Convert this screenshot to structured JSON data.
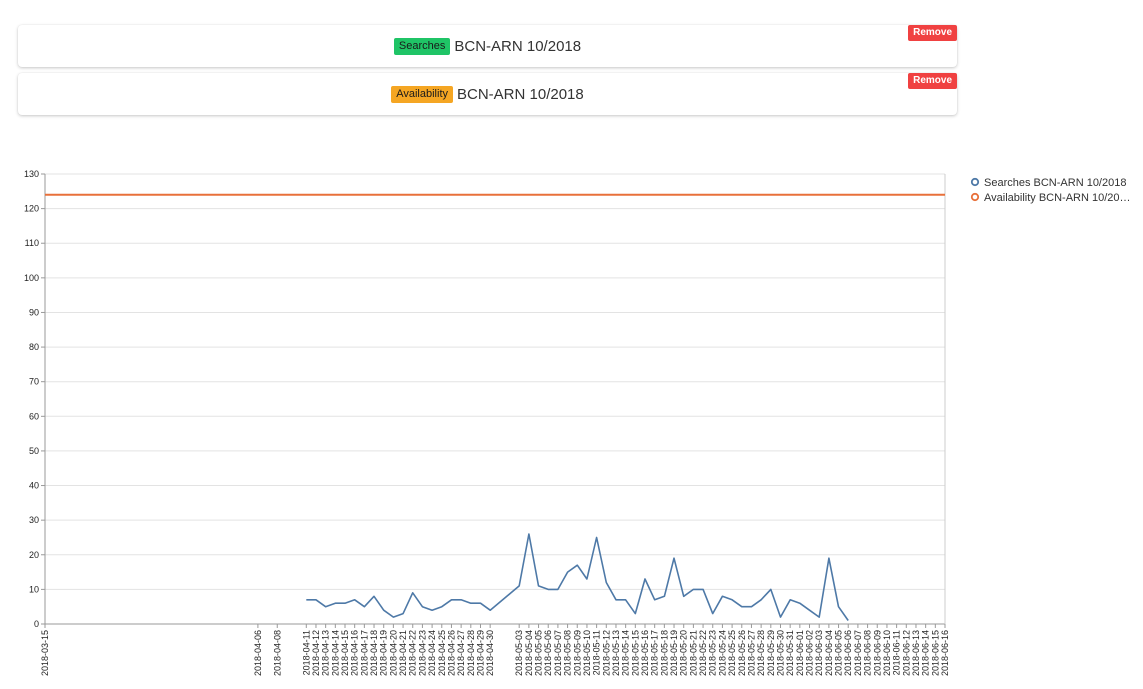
{
  "cards": [
    {
      "tag": "Searches",
      "tag_color": "#1fc466",
      "tag_text_color": "#1a1a1a",
      "route": "BCN-ARN 10/2018",
      "remove_label": "Remove"
    },
    {
      "tag": "Availability",
      "tag_color": "#f5a623",
      "tag_text_color": "#1a1a1a",
      "route": "BCN-ARN 10/2018",
      "remove_label": "Remove"
    }
  ],
  "remove_color": "#f04141",
  "chart_data": {
    "type": "line",
    "ylim": [
      0,
      130
    ],
    "yticks": [
      0,
      10,
      20,
      30,
      40,
      50,
      60,
      70,
      80,
      90,
      100,
      110,
      120,
      130
    ],
    "grid": true,
    "legend_position": "right",
    "series": [
      {
        "name": "Searches BCN-ARN 10/2018",
        "color": "#4e79a7",
        "points": [
          [
            "2018-04-11",
            7
          ],
          [
            "2018-04-12",
            7
          ],
          [
            "2018-04-13",
            5
          ],
          [
            "2018-04-14",
            6
          ],
          [
            "2018-04-15",
            6
          ],
          [
            "2018-04-16",
            7
          ],
          [
            "2018-04-17",
            5
          ],
          [
            "2018-04-18",
            8
          ],
          [
            "2018-04-19",
            4
          ],
          [
            "2018-04-20",
            2
          ],
          [
            "2018-04-21",
            3
          ],
          [
            "2018-04-22",
            9
          ],
          [
            "2018-04-23",
            5
          ],
          [
            "2018-04-24",
            4
          ],
          [
            "2018-04-25",
            5
          ],
          [
            "2018-04-26",
            7
          ],
          [
            "2018-04-27",
            7
          ],
          [
            "2018-04-28",
            6
          ],
          [
            "2018-04-29",
            6
          ],
          [
            "2018-04-30",
            4
          ],
          [
            "2018-05-03",
            11
          ],
          [
            "2018-05-04",
            26
          ],
          [
            "2018-05-05",
            11
          ],
          [
            "2018-05-06",
            10
          ],
          [
            "2018-05-07",
            10
          ],
          [
            "2018-05-08",
            15
          ],
          [
            "2018-05-09",
            17
          ],
          [
            "2018-05-10",
            13
          ],
          [
            "2018-05-11",
            25
          ],
          [
            "2018-05-12",
            12
          ],
          [
            "2018-05-13",
            7
          ],
          [
            "2018-05-14",
            7
          ],
          [
            "2018-05-15",
            3
          ],
          [
            "2018-05-16",
            13
          ],
          [
            "2018-05-17",
            7
          ],
          [
            "2018-05-18",
            8
          ],
          [
            "2018-05-19",
            19
          ],
          [
            "2018-05-20",
            8
          ],
          [
            "2018-05-21",
            10
          ],
          [
            "2018-05-22",
            10
          ],
          [
            "2018-05-23",
            3
          ],
          [
            "2018-05-24",
            8
          ],
          [
            "2018-05-25",
            7
          ],
          [
            "2018-05-26",
            5
          ],
          [
            "2018-05-27",
            5
          ],
          [
            "2018-05-28",
            7
          ],
          [
            "2018-05-29",
            10
          ],
          [
            "2018-05-30",
            2
          ],
          [
            "2018-05-31",
            7
          ],
          [
            "2018-06-01",
            6
          ],
          [
            "2018-06-02",
            4
          ],
          [
            "2018-06-03",
            2
          ],
          [
            "2018-06-04",
            19
          ],
          [
            "2018-06-05",
            5
          ],
          [
            "2018-06-06",
            1
          ]
        ]
      },
      {
        "name": "Availability BCN-ARN 10/20…",
        "color": "#e8703a",
        "points": [
          [
            "2018-03-15",
            124
          ],
          [
            "2018-06-16",
            124
          ]
        ]
      }
    ],
    "xticks": [
      "2018-03-15",
      "2018-04-06",
      "2018-04-08",
      "2018-04-11",
      "2018-04-12",
      "2018-04-13",
      "2018-04-14",
      "2018-04-15",
      "2018-04-16",
      "2018-04-17",
      "2018-04-18",
      "2018-04-19",
      "2018-04-20",
      "2018-04-21",
      "2018-04-22",
      "2018-04-23",
      "2018-04-24",
      "2018-04-25",
      "2018-04-26",
      "2018-04-27",
      "2018-04-28",
      "2018-04-29",
      "2018-04-30",
      "2018-05-03",
      "2018-05-04",
      "2018-05-05",
      "2018-05-06",
      "2018-05-07",
      "2018-05-08",
      "2018-05-09",
      "2018-05-10",
      "2018-05-11",
      "2018-05-12",
      "2018-05-13",
      "2018-05-14",
      "2018-05-15",
      "2018-05-16",
      "2018-05-17",
      "2018-05-18",
      "2018-05-19",
      "2018-05-20",
      "2018-05-21",
      "2018-05-22",
      "2018-05-23",
      "2018-05-24",
      "2018-05-25",
      "2018-05-26",
      "2018-05-27",
      "2018-05-28",
      "2018-05-29",
      "2018-05-30",
      "2018-05-31",
      "2018-06-01",
      "2018-06-02",
      "2018-06-03",
      "2018-06-04",
      "2018-06-05",
      "2018-06-06",
      "2018-06-07",
      "2018-06-08",
      "2018-06-09",
      "2018-06-10",
      "2018-06-11",
      "2018-06-12",
      "2018-06-13",
      "2018-06-14",
      "2018-06-15",
      "2018-06-16"
    ]
  }
}
